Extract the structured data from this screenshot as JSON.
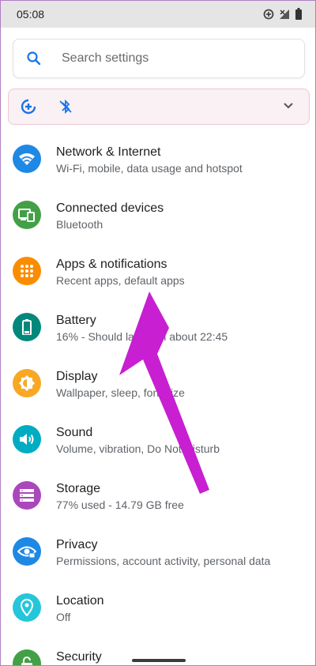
{
  "status_bar": {
    "time": "05:08",
    "icons": [
      "data-saver-icon",
      "no-signal-icon",
      "battery-icon"
    ]
  },
  "search": {
    "placeholder": "Search settings",
    "icon": "search-icon"
  },
  "suggestion": {
    "icons": [
      "data-saver-icon",
      "bluetooth-off-icon"
    ],
    "expand_icon": "chevron-down-icon"
  },
  "settings": [
    {
      "title": "Network & Internet",
      "subtitle": "Wi-Fi, mobile, data usage and hotspot",
      "icon": "wifi-icon",
      "color": "#1e88e5"
    },
    {
      "title": "Connected devices",
      "subtitle": "Bluetooth",
      "icon": "devices-icon",
      "color": "#43a047"
    },
    {
      "title": "Apps & notifications",
      "subtitle": "Recent apps, default apps",
      "icon": "apps-grid-icon",
      "color": "#fb8c00"
    },
    {
      "title": "Battery",
      "subtitle": "16% - Should last until about 22:45",
      "icon": "battery-icon",
      "color": "#00897b"
    },
    {
      "title": "Display",
      "subtitle": "Wallpaper, sleep, font size",
      "icon": "brightness-icon",
      "color": "#f9a825"
    },
    {
      "title": "Sound",
      "subtitle": "Volume, vibration, Do Not Disturb",
      "icon": "speaker-icon",
      "color": "#00acc1"
    },
    {
      "title": "Storage",
      "subtitle": "77% used - 14.79 GB free",
      "icon": "storage-icon",
      "color": "#ab47bc"
    },
    {
      "title": "Privacy",
      "subtitle": "Permissions, account activity, personal data",
      "icon": "eye-icon",
      "color": "#1e88e5"
    },
    {
      "title": "Location",
      "subtitle": "Off",
      "icon": "location-pin-icon",
      "color": "#26c6da"
    },
    {
      "title": "Security",
      "subtitle": "",
      "icon": "lock-icon",
      "color": "#43a047"
    }
  ],
  "annotation": {
    "arrow_icon": "pointer-arrow-icon",
    "color": "#c71fd1"
  }
}
